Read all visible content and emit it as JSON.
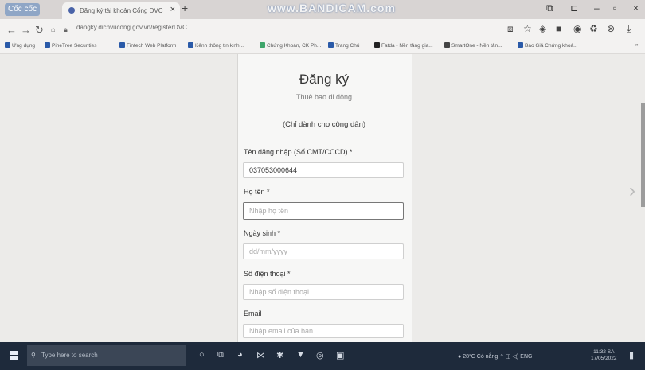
{
  "browser": {
    "brand": "Cốc cốc",
    "tab_title": "Đăng ký tài khoản Cổng DVC",
    "tab_close": "×",
    "new_tab": "+",
    "watermark": "www.BANDICAM.com",
    "url": "dangky.dichvucong.gov.vn/registerDVC",
    "bookmarks": [
      "Ứng dụng",
      "PineTree Securities",
      "Fintech Web Platform",
      "Kênh thông tin kinh...",
      "Chứng Khoán, CK Ph...",
      "Trang Chủ",
      "Fatda - Nền tảng gia...",
      "SmartOne - Nền tản...",
      "Báo Giá Chứng khoá..."
    ],
    "bookmarks_more": "»"
  },
  "form": {
    "title": "Đăng ký",
    "subtitle": "Thuê bao di động",
    "note": "(Chỉ dành cho công dân)",
    "id_label": "Tên đăng nhập (Số CMT/CCCD) *",
    "id_value": "037053000644",
    "name_label": "Họ tên *",
    "name_placeholder": "Nhập họ tên",
    "dob_label": "Ngày sinh *",
    "dob_placeholder": "dd/mm/yyyy",
    "phone_label": "Số điện thoại *",
    "phone_placeholder": "Nhập số điện thoại",
    "email_label": "Email",
    "email_placeholder": "Nhập email của bạn"
  },
  "taskbar": {
    "search_placeholder": "Type here to search",
    "weather": "28°C Có nắng",
    "language": "ENG",
    "time": "11:32 SA",
    "date": "17/05/2022"
  },
  "colors": {
    "taskbar": "#1e2a3b",
    "page_bg": "#ecebe9",
    "form_bg": "#f7f7f6"
  }
}
